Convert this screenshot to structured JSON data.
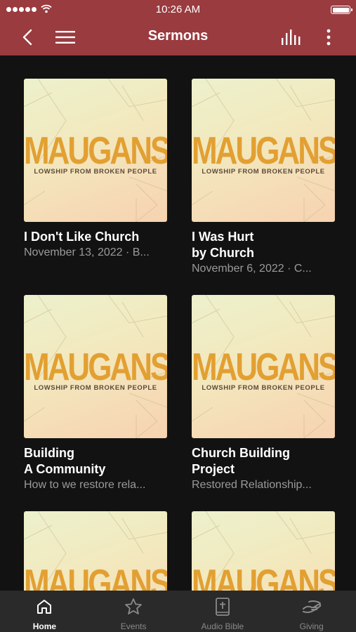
{
  "status_bar": {
    "time": "10:26 AM"
  },
  "nav": {
    "title": "Sermons",
    "back_icon": "chevron-left-icon",
    "menu_icon": "hamburger-icon",
    "audio_icon": "equalizer-icon",
    "more_icon": "more-vertical-icon"
  },
  "sermons": [
    {
      "brand": "MAUGANSVILLE",
      "tagline": "LOWSHIP FROM BROKEN PEOPLE",
      "title": "I Don't Like Church",
      "subtitle": "November 13, 2022 · B..."
    },
    {
      "brand": "MAUGANSVILLE",
      "tagline": "LOWSHIP FROM BROKEN PEOPLE",
      "title": "I Was Hurt\nby Church",
      "subtitle": "November 6, 2022 · C..."
    },
    {
      "brand": "MAUGANSVILLE",
      "tagline": "LOWSHIP FROM BROKEN PEOPLE",
      "title": "Building\nA Community",
      "subtitle": "How to we restore rela..."
    },
    {
      "brand": "MAUGANSVILLE",
      "tagline": "LOWSHIP FROM BROKEN PEOPLE",
      "title": "Church Building\nProject",
      "subtitle": "Restored Relationship..."
    },
    {
      "brand": "MAUGANSVILLE",
      "tagline": "",
      "title": "",
      "subtitle": ""
    },
    {
      "brand": "MAUGANSVILLE",
      "tagline": "",
      "title": "",
      "subtitle": ""
    }
  ],
  "tabs": [
    {
      "label": "Home",
      "icon": "home-icon",
      "active": true
    },
    {
      "label": "Events",
      "icon": "star-icon",
      "active": false
    },
    {
      "label": "Audio Bible",
      "icon": "bible-icon",
      "active": false
    },
    {
      "label": "Giving",
      "icon": "giving-hand-icon",
      "active": false
    }
  ],
  "colors": {
    "header": "#9a3b3f",
    "background": "#121212",
    "tabbar": "#2a2a2a",
    "brand": "#e2a032"
  }
}
